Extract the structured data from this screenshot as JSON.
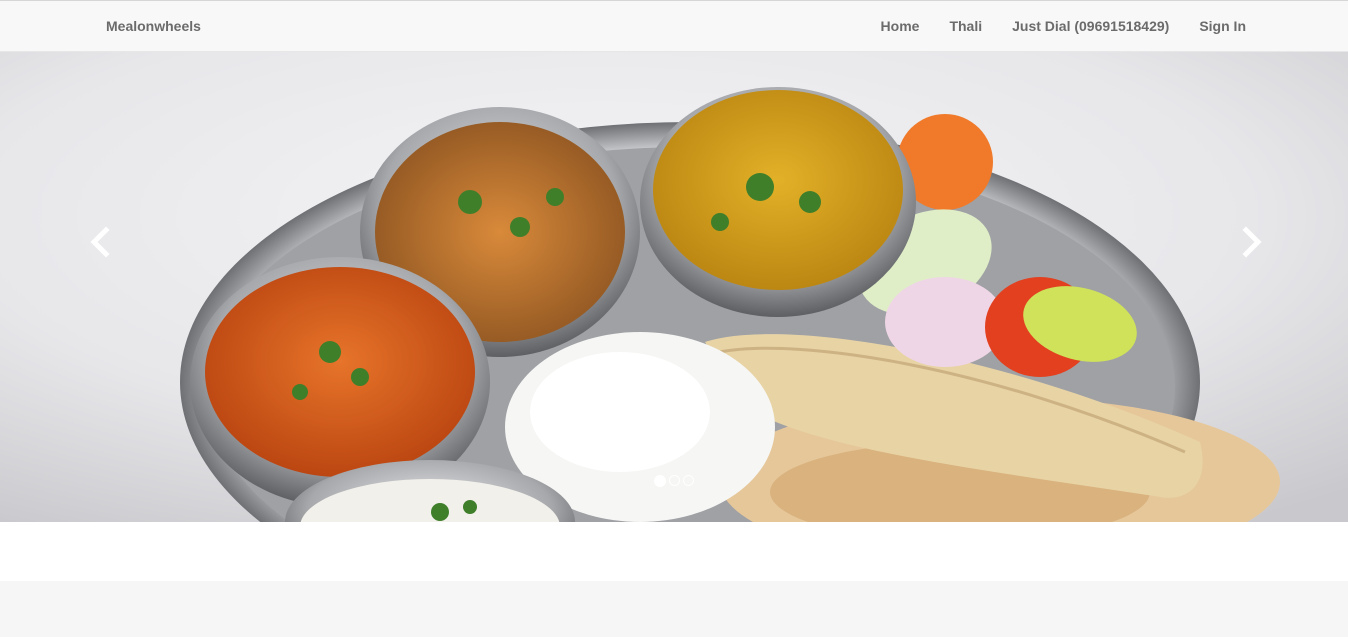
{
  "navbar": {
    "brand": "Mealonwheels",
    "links": [
      "Home",
      "Thali",
      "Just Dial (09691518429)",
      "Sign In"
    ]
  },
  "carousel": {
    "slide_image": "thali-meal-photo",
    "indicator_count": 3,
    "active_index": 0,
    "prev_icon": "chevron-left-icon",
    "next_icon": "chevron-right-icon"
  }
}
